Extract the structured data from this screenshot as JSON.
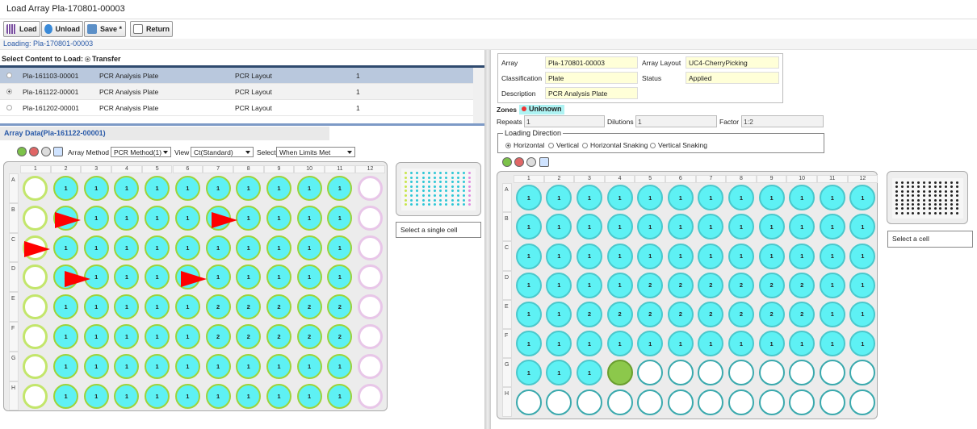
{
  "window": {
    "title": "Load Array Pla-170801-00003"
  },
  "toolbar": {
    "load": "Load",
    "unload": "Unload",
    "save": "Save *",
    "ret": "Return"
  },
  "loading": "Loading: Pla-170801-00003",
  "select_content": {
    "label": "Select Content to Load:",
    "option": "Transfer"
  },
  "content_rows": [
    [
      "Pla-161103-00001",
      "PCR Analysis Plate",
      "PCR Layout",
      "1"
    ],
    [
      "Pla-161122-00001",
      "PCR Analysis Plate",
      "PCR Layout",
      "1"
    ],
    [
      "Pla-161202-00001",
      "PCR Analysis Plate",
      "PCR Layout",
      "1"
    ]
  ],
  "array_data": {
    "title": "Array Data(Pla-161122-00001)",
    "method_label": "Array Method",
    "method": "PCR Method(1)",
    "view_label": "View",
    "view": "Ct(Standard)",
    "select_label": "Select",
    "select": "When Limits Met",
    "message": "Select a single cell"
  },
  "array_info": {
    "array_label": "Array",
    "array": "Pla-170801-00003",
    "layout_label": "Array Layout",
    "layout": "UC4-CherryPicking",
    "class_label": "Classification",
    "class": "Plate",
    "status_label": "Status",
    "status": "Applied",
    "desc_label": "Description",
    "desc": "PCR Analysis Plate"
  },
  "zones": {
    "label": "Zones :",
    "value": "Unknown"
  },
  "repeats": {
    "label": "Repeats",
    "value": "1"
  },
  "dilutions": {
    "label": "Dilutions",
    "value": "1"
  },
  "factor": {
    "label": "Factor",
    "value": "1:2"
  },
  "loading_direction": {
    "label": "Loading Direction",
    "options": [
      "Horizontal",
      "Vertical",
      "Horizontal Snaking",
      "Vertical Snaking"
    ]
  },
  "right_message": "Select a cell",
  "cols": [
    "1",
    "2",
    "3",
    "4",
    "5",
    "6",
    "7",
    "8",
    "9",
    "10",
    "11",
    "12"
  ],
  "rows": [
    "A",
    "B",
    "C",
    "D",
    "E",
    "F",
    "G",
    "H"
  ],
  "left_plate": [
    [
      "",
      "1",
      "1",
      "1",
      "1",
      "1",
      "1",
      "1",
      "1",
      "1",
      "1",
      ""
    ],
    [
      "",
      "1",
      "1",
      "1",
      "1",
      "1",
      "1",
      "1",
      "1",
      "1",
      "1",
      ""
    ],
    [
      "",
      "1",
      "1",
      "1",
      "1",
      "1",
      "1",
      "1",
      "1",
      "1",
      "1",
      ""
    ],
    [
      "",
      "1",
      "1",
      "1",
      "1",
      "1",
      "1",
      "1",
      "1",
      "1",
      "1",
      ""
    ],
    [
      "",
      "1",
      "1",
      "1",
      "1",
      "1",
      "2",
      "2",
      "2",
      "2",
      "2",
      ""
    ],
    [
      "",
      "1",
      "1",
      "1",
      "1",
      "1",
      "2",
      "2",
      "2",
      "2",
      "2",
      ""
    ],
    [
      "",
      "1",
      "1",
      "1",
      "1",
      "1",
      "1",
      "1",
      "1",
      "1",
      "1",
      ""
    ],
    [
      "",
      "1",
      "1",
      "1",
      "1",
      "1",
      "1",
      "1",
      "1",
      "1",
      "1",
      ""
    ]
  ],
  "right_plate": [
    [
      "1",
      "1",
      "1",
      "1",
      "1",
      "1",
      "1",
      "1",
      "1",
      "1",
      "1",
      "1"
    ],
    [
      "1",
      "1",
      "1",
      "1",
      "1",
      "1",
      "1",
      "1",
      "1",
      "1",
      "1",
      "1"
    ],
    [
      "1",
      "1",
      "1",
      "1",
      "1",
      "1",
      "1",
      "1",
      "1",
      "1",
      "1",
      "1"
    ],
    [
      "1",
      "1",
      "1",
      "1",
      "2",
      "2",
      "2",
      "2",
      "2",
      "2",
      "1",
      "1"
    ],
    [
      "1",
      "1",
      "2",
      "2",
      "2",
      "2",
      "2",
      "2",
      "2",
      "2",
      "1",
      "1"
    ],
    [
      "1",
      "1",
      "1",
      "1",
      "1",
      "1",
      "1",
      "1",
      "1",
      "1",
      "1",
      "1"
    ],
    [
      "1",
      "1",
      "1",
      "",
      "",
      "",
      "",
      "",
      "",
      "",
      "",
      ""
    ],
    [
      "",
      "",
      "",
      "",
      "",
      "",
      "",
      "",
      "",
      "",
      "",
      ""
    ]
  ],
  "colors": {
    "cyan": "#5ef1f4",
    "green_ring": "#9dd33a",
    "filled_green": "#8cc84b",
    "arrow": "#ff0000",
    "header_blue": "#2f4a6e"
  }
}
